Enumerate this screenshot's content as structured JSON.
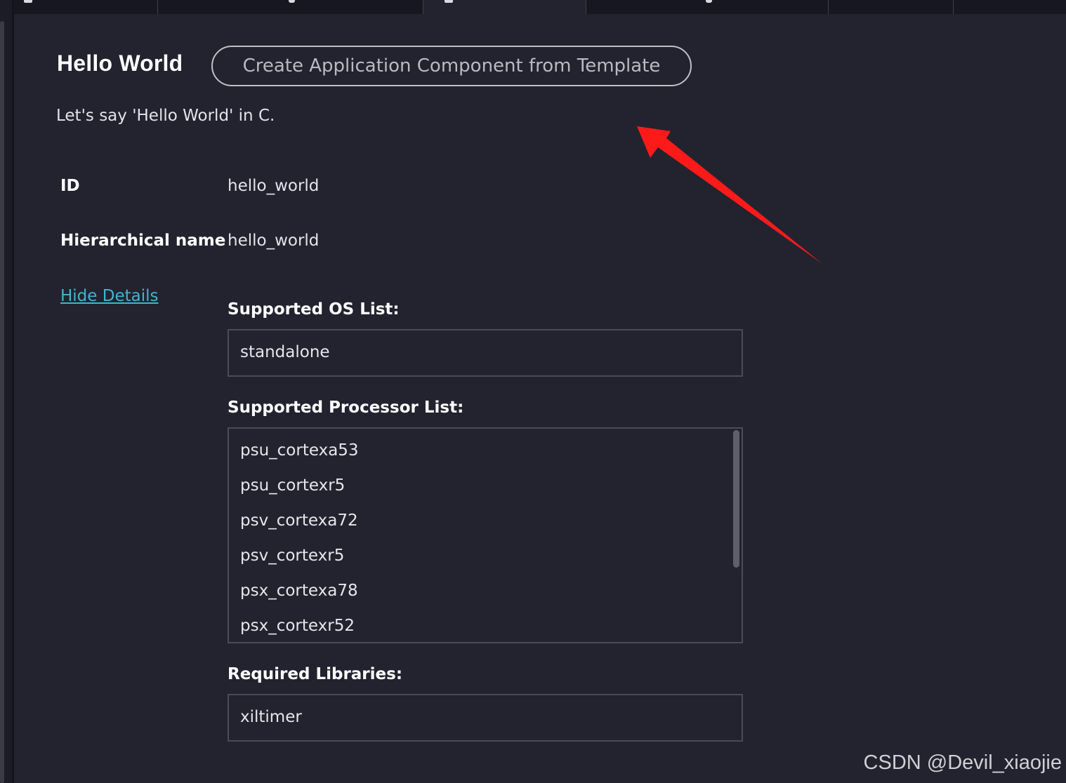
{
  "header": {
    "title": "Hello World",
    "create_button_label": "Create Application Component from Template",
    "description": "Let's say 'Hello World' in C."
  },
  "fields": {
    "id_label": "ID",
    "id_value": "hello_world",
    "hier_label": "Hierarchical name",
    "hier_value": "hello_world"
  },
  "details": {
    "toggle_link": "Hide Details",
    "os_list_label": "Supported OS List:",
    "os_list": [
      "standalone"
    ],
    "processor_list_label": "Supported Processor List:",
    "processor_list": [
      "psu_cortexa53",
      "psu_cortexr5",
      "psv_cortexa72",
      "psv_cortexr5",
      "psx_cortexa78",
      "psx_cortexr52"
    ],
    "libraries_label": "Required Libraries:",
    "libraries": [
      "xiltimer"
    ]
  },
  "watermark": "CSDN @Devil_xiaojie",
  "colors": {
    "background": "#22232f",
    "link": "#3fb6cf",
    "arrow": "#ff1a1a",
    "box_border": "#4a4b56"
  },
  "icons": [
    "annotation-arrow-icon"
  ]
}
